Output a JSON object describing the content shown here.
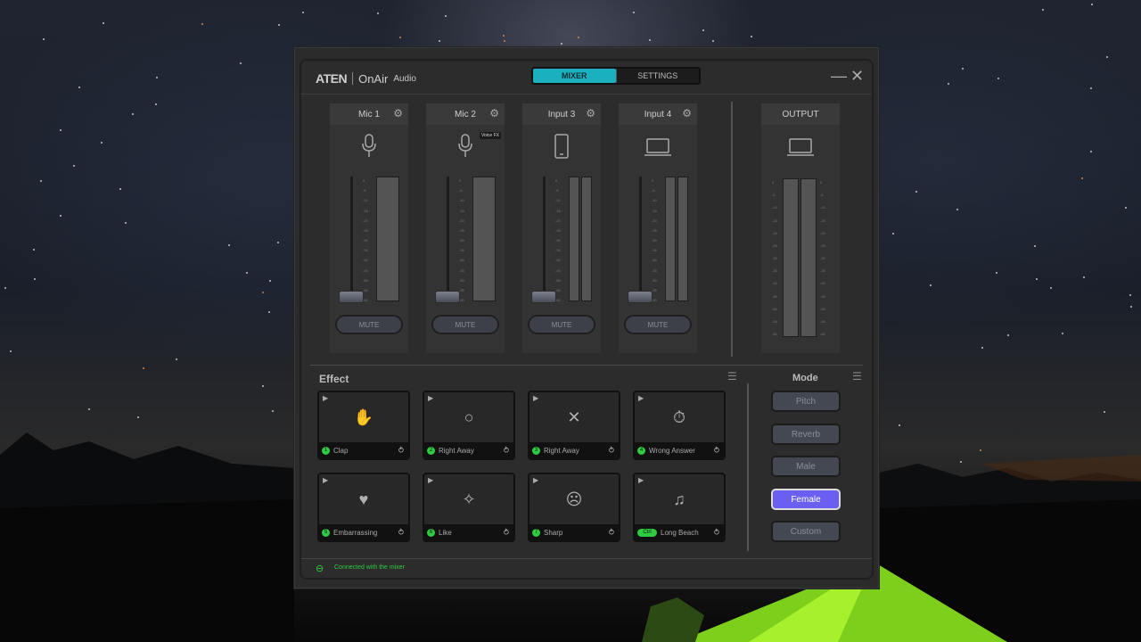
{
  "app": {
    "brand": "ATEN",
    "product": "OnAir",
    "product_sub": "Audio",
    "tabs": [
      {
        "label": "MIXER",
        "active": true
      },
      {
        "label": "SETTINGS",
        "active": false
      }
    ],
    "minimize_icon": "minimize-icon",
    "close_icon": "close-icon"
  },
  "channels": [
    {
      "label": "Mic 1",
      "icon": "microphone-icon",
      "mute_label": "MUTE",
      "fader_level": 0.0,
      "meters": 1
    },
    {
      "label": "Mic 2",
      "icon": "microphone-icon",
      "badge": "Voice FX",
      "mute_label": "MUTE",
      "fader_level": 0.0,
      "meters": 1
    },
    {
      "label": "Input 3",
      "icon": "phone-icon",
      "mute_label": "MUTE",
      "fader_level": 0.0,
      "meters": 2
    },
    {
      "label": "Input 4",
      "icon": "laptop-icon",
      "mute_label": "MUTE",
      "fader_level": 0.0,
      "meters": 2
    }
  ],
  "scale_labels": [
    "0",
    "-5",
    "-10",
    "-15",
    "-20",
    "-25",
    "-30",
    "-35",
    "-40",
    "-45",
    "-50",
    "-55",
    "-60"
  ],
  "output": {
    "label": "OUTPUT",
    "icon": "laptop-icon",
    "meters": 2
  },
  "effect": {
    "title": "Effect",
    "pads": [
      {
        "num": "1",
        "label": "Clap",
        "icon": "clap-icon"
      },
      {
        "num": "2",
        "label": "Right Away",
        "icon": "circle-icon"
      },
      {
        "num": "3",
        "label": "Right Away",
        "icon": "cross-icon"
      },
      {
        "num": "4",
        "label": "Wrong Answer",
        "icon": "stopwatch-icon"
      },
      {
        "num": "5",
        "label": "Embarrassing",
        "icon": "heart-icon"
      },
      {
        "num": "6",
        "label": "Like",
        "icon": "sparkle-icon"
      },
      {
        "num": "7",
        "label": "Sharp",
        "icon": "sad-face-icon"
      },
      {
        "num": "Ctrl",
        "label": "Long Beach",
        "icon": "music-note-icon"
      }
    ]
  },
  "mode": {
    "title": "Mode",
    "options": [
      {
        "label": "Pitch",
        "active": false
      },
      {
        "label": "Reverb",
        "active": false
      },
      {
        "label": "Male",
        "active": false
      },
      {
        "label": "Female",
        "active": true
      },
      {
        "label": "Custom",
        "active": false
      }
    ]
  },
  "status": {
    "text": "Connected with the mixer",
    "color": "#2ecc40"
  },
  "colors": {
    "accent": "#1ab0c0",
    "mode_active": "#6a5ff0",
    "status_green": "#2ecc40"
  }
}
